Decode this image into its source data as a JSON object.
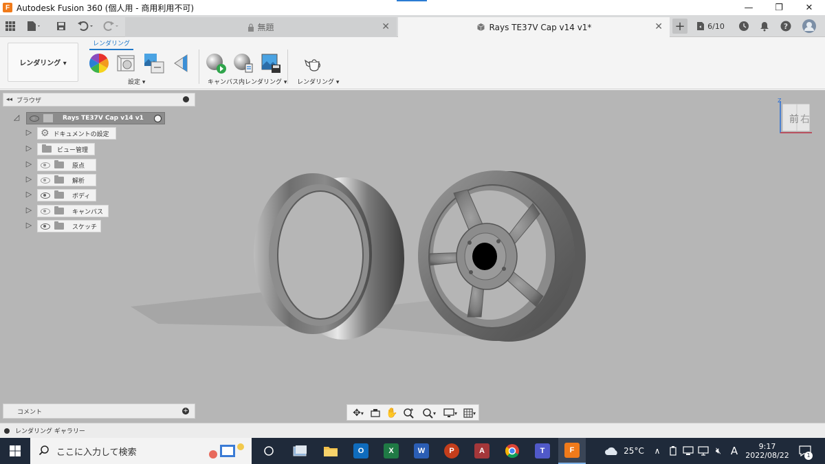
{
  "window": {
    "title": "Autodesk Fusion 360 (個人用 - 商用利用不可)",
    "app_icon_letter": "F",
    "controls": {
      "minimize": "—",
      "maximize": "❐",
      "close": "✕"
    }
  },
  "tabs": [
    {
      "label": "無題",
      "icon": "lock-icon"
    },
    {
      "label": "Rays TE37V Cap v14 v1*",
      "icon": "box-icon"
    }
  ],
  "job_status": "6/10",
  "ribbon": {
    "workspace_label": "レンダリング ▾",
    "active_tab": "レンダリング",
    "groups": [
      {
        "label": "設定 ▾"
      },
      {
        "label": "キャンバス内レンダリング ▾"
      },
      {
        "label": "レンダリング ▾"
      }
    ]
  },
  "browser": {
    "title": "ブラウザ",
    "root": "Rays TE37V Cap v14 v1",
    "items": [
      {
        "label": "ドキュメントの設定",
        "icon": "gear-icon",
        "eye": "none"
      },
      {
        "label": "ビュー管理",
        "icon": "folder-icon",
        "eye": "none"
      },
      {
        "label": "原点",
        "icon": "folder-icon",
        "eye": "hidden"
      },
      {
        "label": "解析",
        "icon": "folder-icon",
        "eye": "hidden"
      },
      {
        "label": "ボディ",
        "icon": "folder-icon",
        "eye": "visible"
      },
      {
        "label": "キャンバス",
        "icon": "folder-icon",
        "eye": "hidden"
      },
      {
        "label": "スケッチ",
        "icon": "folder-icon",
        "eye": "visible"
      }
    ]
  },
  "viewcube": {
    "front": "前",
    "right": "右",
    "z": "Z"
  },
  "comments_label": "コメント",
  "gallery_label": "レンダリング ギャラリー",
  "taskbar": {
    "search_placeholder": "ここに入力して検索",
    "weather": "25°C",
    "ime": "A",
    "time": "9:17",
    "date": "2022/08/22",
    "notification_count": "1",
    "apps": [
      {
        "name": "outlook",
        "letter": "O",
        "color": "#0f6cbd"
      },
      {
        "name": "excel",
        "letter": "X",
        "color": "#1f7a45"
      },
      {
        "name": "word",
        "letter": "W",
        "color": "#2b5eb5"
      },
      {
        "name": "powerpoint",
        "letter": "P",
        "color": "#c43e1c"
      },
      {
        "name": "access",
        "letter": "A",
        "color": "#a4373a"
      },
      {
        "name": "teams",
        "letter": "T",
        "color": "#5059c9"
      },
      {
        "name": "fusion",
        "letter": "F",
        "color": "#f07a1a"
      }
    ]
  }
}
